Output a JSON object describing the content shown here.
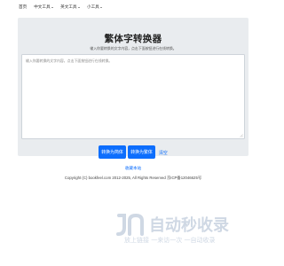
{
  "nav": {
    "home": "首页",
    "items": [
      {
        "label": "中文工具"
      },
      {
        "label": "英文工具"
      },
      {
        "label": "小工具"
      }
    ]
  },
  "main": {
    "title": "繁体字转换器",
    "subtitle": "输入你要转换的文字内容，点击下面按钮进行在线转换。",
    "textarea_placeholder": "输入你要转换的文字内容，点击下面按钮进行在线转换。",
    "btn_to_simplified": "转换为简体",
    "btn_to_traditional": "转换为繁体",
    "clear_label": "清空"
  },
  "footer": {
    "favorite": "收藏本站",
    "copyright": "Copyright (C) bookfeel.com 2012-2025, All Rights Reserved 京ICP备12046625号"
  },
  "watermark": {
    "brand": "自动秒收录",
    "tagline": "放上链接 一来访一次 一自动收录"
  },
  "colors": {
    "accent": "#0d6efd",
    "panel_bg": "#e9ecef",
    "watermark": "#cfd8e4"
  }
}
